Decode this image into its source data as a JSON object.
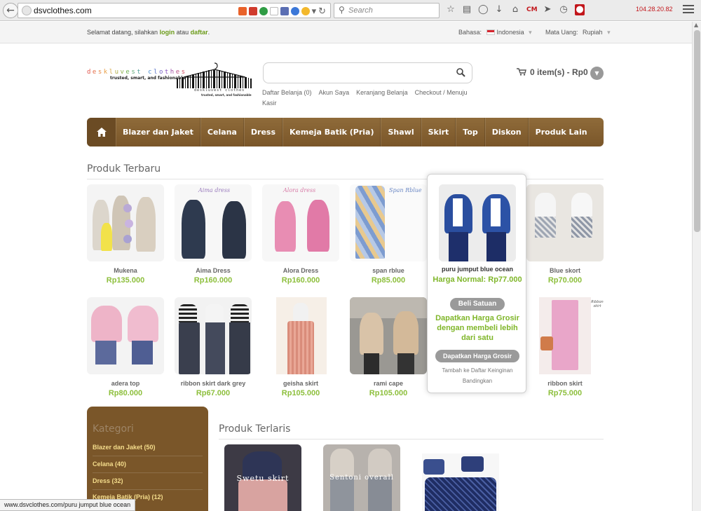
{
  "browser": {
    "url": "dsvclothes.com",
    "search_placeholder": "Search",
    "ip": "104.28.20.82"
  },
  "topbar": {
    "welcome_prefix": "Selamat datang, silahkan",
    "login": "login",
    "atau": "atau",
    "daftar": "daftar",
    "period": ".",
    "bahasa_label": "Bahasa:",
    "bahasa_value": "Indonesia",
    "mata_uang_label": "Mata Uang:",
    "mata_uang_value": "Rupiah"
  },
  "logo": {
    "name_top": "deskluvest clothes",
    "tagline": "trusted, smart, and fashionable",
    "name_bottom": "deskluvest clothes",
    "tagline_bottom": "trusted, smart, and fashionable"
  },
  "header": {
    "links": [
      "Daftar Belanja (0)",
      "Akun Saya",
      "Keranjang Belanja",
      "Checkout / Menuju Kasir"
    ],
    "cart_text": "0 item(s) - Rp0"
  },
  "nav": {
    "items": [
      "Blazer dan Jaket",
      "Celana",
      "Dress",
      "Kemeja Batik (Pria)",
      "Shawl",
      "Skirt",
      "Top",
      "Diskon",
      "Produk Lain"
    ]
  },
  "sections": {
    "terbaru": "Produk Terbaru",
    "terlaris": "Produk Terlaris"
  },
  "products_row1": [
    {
      "name": "Mukena",
      "price": "Rp135.000"
    },
    {
      "name": "Aima Dress",
      "price": "Rp160.000",
      "overlay": "Aima dress"
    },
    {
      "name": "Alora Dress",
      "price": "Rp160.000",
      "overlay": "Alora dress"
    },
    {
      "name": "span rblue",
      "price": "Rp85.000",
      "overlay": "Span Rblue"
    },
    {
      "name": "Blue skort",
      "price": "Rp70.000"
    }
  ],
  "products_row2": [
    {
      "name": "adera top",
      "price": "Rp80.000"
    },
    {
      "name": "ribbon skirt dark grey",
      "price": "Rp67.000"
    },
    {
      "name": "geisha skirt",
      "price": "Rp105.000"
    },
    {
      "name": "rami cape",
      "price": "Rp105.000"
    },
    {
      "name": "ribbon skirt",
      "price": "Rp75.000",
      "overlay": "Ribbon skirt"
    }
  ],
  "popup": {
    "name": "puru jumput blue ocean",
    "harga": "Harga Normal: Rp77.000",
    "beli": "Beli Satuan",
    "grosir_text": "Dapatkan Harga Grosir dengan membeli lebih dari satu",
    "grosir_btn": "Dapatkan Harga Grosir",
    "wishlist": "Tambah ke Daftar Keinginan",
    "compare": "Bandingkan"
  },
  "terlaris": [
    {
      "overlay": "Swetu skirt"
    },
    {
      "overlay": "Sentoni overall"
    },
    {
      "overlay": ""
    }
  ],
  "sidebar": {
    "title": "Kategori",
    "items": [
      "Blazer dan Jaket (50)",
      "Celana (40)",
      "Dress (32)",
      "Kemeja Batik (Pria) (12)"
    ]
  },
  "status": "www.dsvclothes.com/puru jumput blue ocean",
  "colors": {
    "nav_brown": "#7a5629",
    "price_green": "#8dbf3c",
    "link_green": "#6a9a17"
  }
}
